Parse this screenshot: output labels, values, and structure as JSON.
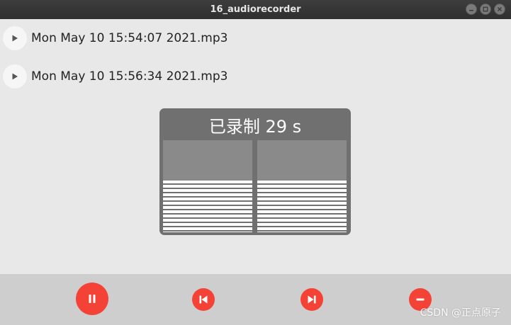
{
  "window": {
    "title": "16_audiorecorder"
  },
  "recordings": [
    {
      "file_name": "Mon May 10 15:54:07 2021.mp3",
      "icon": "play-icon"
    },
    {
      "file_name": "Mon May 10 15:56:34 2021.mp3",
      "icon": "play-icon"
    }
  ],
  "recorder_panel": {
    "status_text": "已录制 29 s",
    "channels": 2,
    "level_fraction": 0.56
  },
  "controls": [
    {
      "icon": "pause-icon"
    },
    {
      "icon": "previous-icon"
    },
    {
      "icon": "next-icon"
    },
    {
      "icon": "remove-icon"
    }
  ],
  "watermark": "CSDN @正点原子",
  "colors": {
    "titlebar": "#333333",
    "background": "#e8e8e8",
    "bottom_bar": "#cecece",
    "accent": "#f44336",
    "panel": "#707070",
    "meter_inactive": "#8a8a8a"
  }
}
